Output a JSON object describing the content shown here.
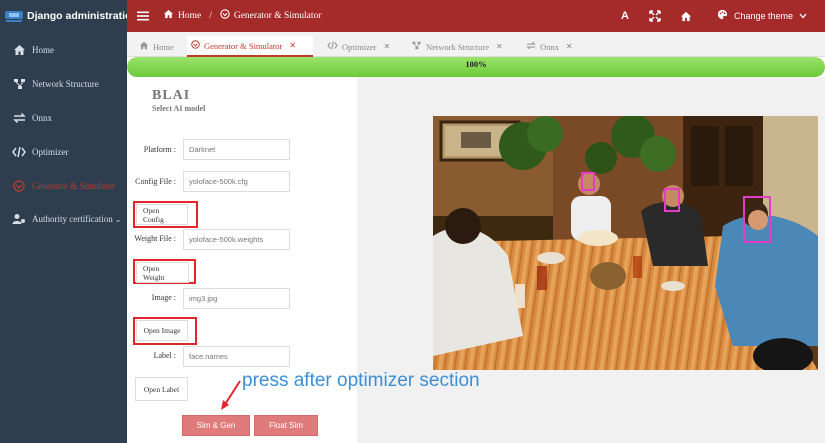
{
  "app": {
    "title": "Django administration"
  },
  "sidebar": {
    "items": [
      {
        "label": "Home",
        "icon": "home-icon"
      },
      {
        "label": "Network Structure",
        "icon": "network-icon"
      },
      {
        "label": "Onnx",
        "icon": "swap-icon"
      },
      {
        "label": "Optimizer",
        "icon": "code-icon"
      },
      {
        "label": "Generator & Simulator",
        "icon": "generator-icon",
        "active": true
      },
      {
        "label": "Authority certification",
        "icon": "users-icon"
      }
    ]
  },
  "topbar": {
    "breadcrumb": {
      "home": "Home",
      "sep": "/",
      "current": "Generator & Simulator"
    },
    "font_tool": "A",
    "theme_label": "Change theme",
    "bg_color": "#a52a2a"
  },
  "tabs": [
    {
      "label": "Home"
    },
    {
      "label": "Generator & Simulator",
      "active": true
    },
    {
      "label": "Optimizer"
    },
    {
      "label": "Network Structure"
    },
    {
      "label": "Onnx"
    }
  ],
  "progress": {
    "value": 1.0,
    "label": "100%"
  },
  "form": {
    "title": "BLAI",
    "subtitle": "Select AI model",
    "platform": {
      "label": "Platform :",
      "value": "Darknet"
    },
    "config": {
      "label": "Config File :",
      "value": "yoloface-500k.cfg",
      "button": "Open Config"
    },
    "weight": {
      "label": "Weight File :",
      "value": "yoloface-500k.weights",
      "button": "Open Weight"
    },
    "image": {
      "label": "Image :",
      "value": "img3.jpg",
      "button": "Open Image"
    },
    "label_file": {
      "label": "Label :",
      "value": "face.names",
      "button": "Open Label"
    },
    "sim_gen": "Sim & Gen",
    "float_sim": "Float Sim"
  },
  "annotation": {
    "text": "press after optimizer section",
    "color": "#3b8fd6"
  },
  "detections": {
    "count": 3,
    "color": "#e53cc8"
  },
  "colors": {
    "accent": "#c0392b",
    "highlight": "#e3262d",
    "progress": "#7ed348"
  }
}
